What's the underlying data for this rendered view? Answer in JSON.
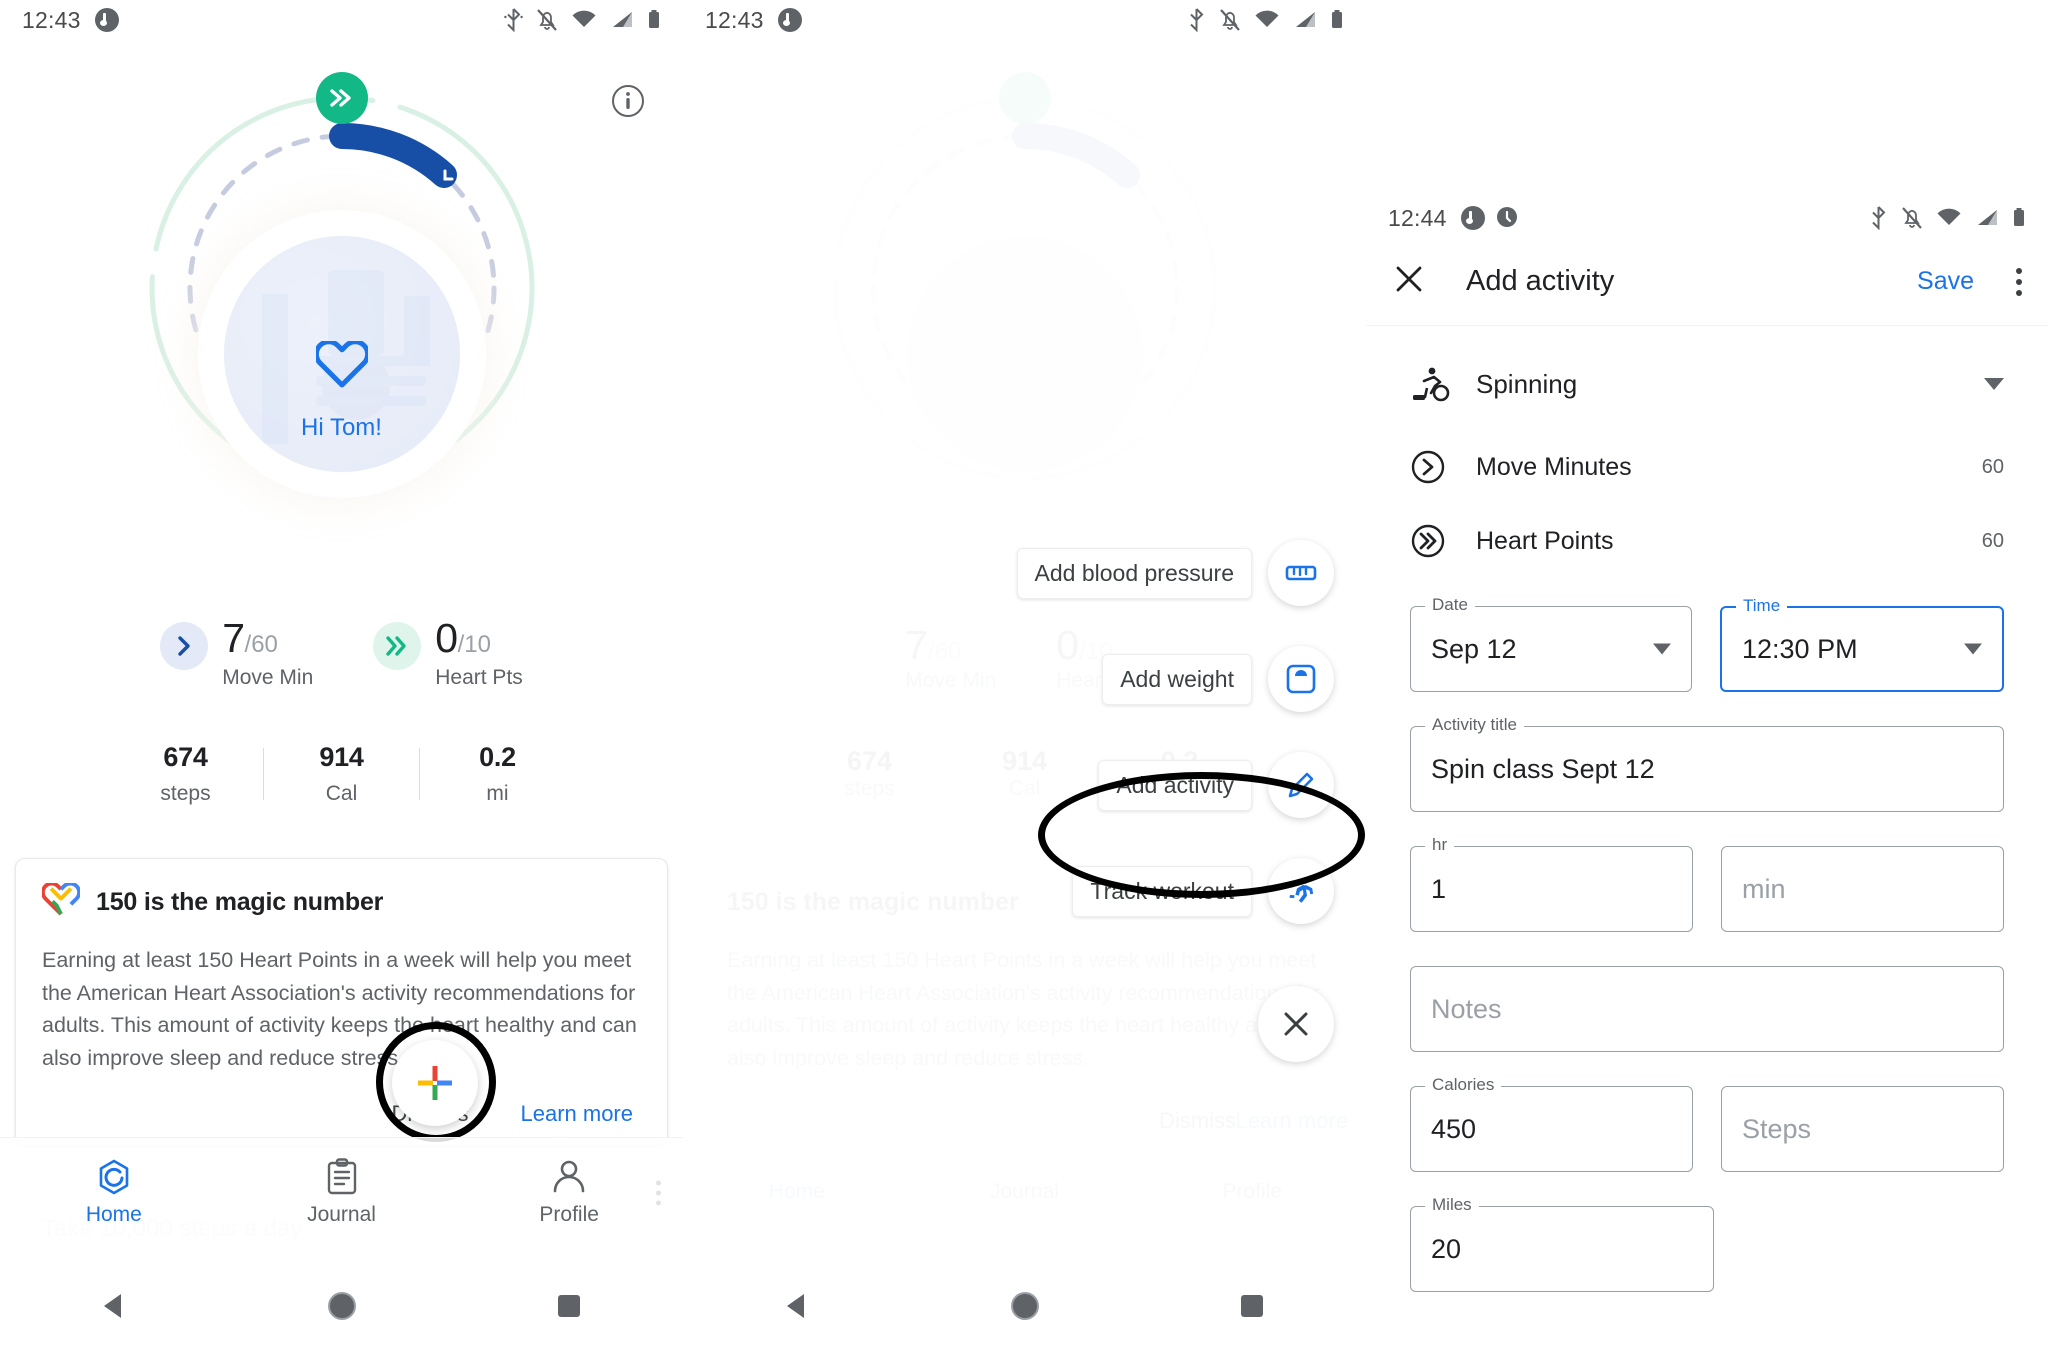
{
  "panel1": {
    "status": {
      "time": "12:43",
      "icons_left": [
        "music-note-icon"
      ],
      "icons_right": [
        "bluetooth-icon",
        "notifications-off-icon",
        "wifi-icon",
        "cell-signal-icon",
        "battery-icon"
      ]
    },
    "info_icon": "info-icon",
    "greeting": "Hi Tom!",
    "goals": [
      {
        "icon": "move-minutes-icon",
        "value": "7",
        "denominator": "/60",
        "label": "Move Min"
      },
      {
        "icon": "heart-points-icon",
        "value": "0",
        "denominator": "/10",
        "label": "Heart Pts"
      }
    ],
    "stats": [
      {
        "value": "674",
        "label": "steps"
      },
      {
        "value": "914",
        "label": "Cal"
      },
      {
        "value": "0.2",
        "label": "mi"
      }
    ],
    "card": {
      "icon": "google-fit-heart-icon",
      "title": "150 is the magic number",
      "body": "Earning at least 150 Heart Points in a week will help you meet the American Heart Association's activity recommendations for adults. This amount of activity keeps the heart healthy and can also improve sleep and reduce stress.",
      "dismiss": "Dismiss",
      "learn_more": "Learn more"
    },
    "tip_behind_nav": "Take 10,000 steps a day",
    "fab": {
      "icon": "google-plus-icon"
    },
    "bottom_nav": [
      {
        "icon": "home-ring-icon",
        "label": "Home",
        "active": true
      },
      {
        "icon": "journal-clipboard-icon",
        "label": "Journal",
        "active": false
      },
      {
        "icon": "profile-person-icon",
        "label": "Profile",
        "active": false
      }
    ],
    "system_nav": [
      "back-triangle-icon",
      "home-circle-icon",
      "recents-square-icon"
    ]
  },
  "panel2": {
    "status": {
      "time": "12:43",
      "icons_left": [
        "music-note-icon"
      ],
      "icons_right": [
        "bluetooth-icon",
        "notifications-off-icon",
        "wifi-icon",
        "cell-signal-icon",
        "battery-icon"
      ]
    },
    "speed_dial": [
      {
        "label": "Add blood pressure",
        "icon": "blood-pressure-cuff-icon"
      },
      {
        "label": "Add weight",
        "icon": "weight-scale-icon"
      },
      {
        "label": "Add activity",
        "icon": "pencil-edit-icon",
        "highlighted": true
      },
      {
        "label": "Track workout",
        "icon": "running-person-icon"
      }
    ],
    "close": {
      "icon": "close-x-icon"
    },
    "system_nav": [
      "back-triangle-icon",
      "home-circle-icon",
      "recents-square-icon"
    ]
  },
  "panel3": {
    "status": {
      "time": "12:44",
      "icons_left": [
        "music-note-icon",
        "assistant-mic-icon"
      ],
      "icons_right": [
        "bluetooth-icon",
        "notifications-off-icon",
        "wifi-icon",
        "cell-signal-icon",
        "battery-icon"
      ]
    },
    "appbar": {
      "close_icon": "close-x-icon",
      "title": "Add activity",
      "save_label": "Save",
      "overflow_icon": "kebab-menu-icon"
    },
    "activity": {
      "icon": "spinning-bike-icon",
      "name": "Spinning",
      "caret_icon": "chevron-down-icon"
    },
    "metrics": [
      {
        "icon": "move-minutes-icon",
        "label": "Move Minutes",
        "value": "60"
      },
      {
        "icon": "heart-points-icon",
        "label": "Heart Points",
        "value": "60"
      }
    ],
    "fields": {
      "date": {
        "legend": "Date",
        "value": "Sep 12",
        "type": "select",
        "focused": false
      },
      "time": {
        "legend": "Time",
        "value": "12:30 PM",
        "type": "select",
        "focused": true
      },
      "title": {
        "legend": "Activity title",
        "value": "Spin class Sept 12",
        "type": "text",
        "focused": false
      },
      "hr": {
        "legend": "hr",
        "value": "1",
        "type": "text",
        "focused": false
      },
      "min": {
        "legend": "",
        "placeholder": "min",
        "type": "text",
        "focused": false
      },
      "notes": {
        "legend": "",
        "placeholder": "Notes",
        "type": "text",
        "focused": false
      },
      "calories": {
        "legend": "Calories",
        "value": "450",
        "type": "text",
        "focused": false
      },
      "steps": {
        "legend": "",
        "placeholder": "Steps",
        "type": "text",
        "focused": false
      },
      "miles": {
        "legend": "Miles",
        "value": "20",
        "type": "text",
        "focused": false
      }
    },
    "highlight_save": true
  },
  "colors": {
    "accent_blue": "#1a73e8",
    "deep_blue": "#174ea6",
    "green": "#12b886",
    "text_primary": "#202124",
    "text_secondary": "#5f6368",
    "divider": "#dadce0"
  }
}
